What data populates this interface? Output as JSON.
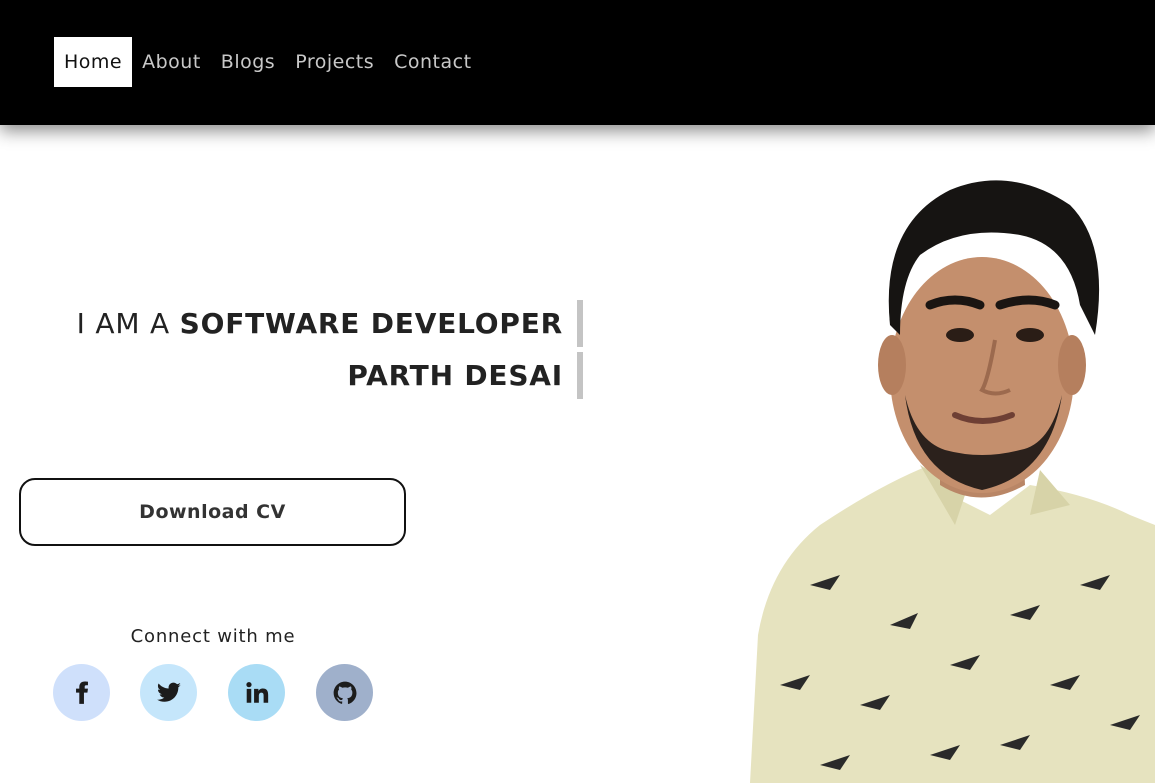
{
  "nav": {
    "items": [
      {
        "label": "Home",
        "active": true
      },
      {
        "label": "About",
        "active": false
      },
      {
        "label": "Blogs",
        "active": false
      },
      {
        "label": "Projects",
        "active": false
      },
      {
        "label": "Contact",
        "active": false
      }
    ]
  },
  "hero": {
    "line1_prefix": "I AM A ",
    "line1_highlight": "SOFTWARE DEVELOPER",
    "line2": "PARTH DESAI"
  },
  "cv_button": {
    "label": "Download CV"
  },
  "connect": {
    "label": "Connect with me",
    "links": [
      {
        "icon": "facebook-icon",
        "bg": "#cfe0fb"
      },
      {
        "icon": "twitter-icon",
        "bg": "#c5e6fb"
      },
      {
        "icon": "linkedin-icon",
        "bg": "#a9dcf5"
      },
      {
        "icon": "github-icon",
        "bg": "#9fb0cb"
      }
    ]
  },
  "colors": {
    "navbar_bg": "#000000",
    "nav_text": "#c8c8c8",
    "nav_active_bg": "#ffffff",
    "page_bg": "#ffffff",
    "text": "#222222",
    "cursor_bar": "#c4c4c4"
  }
}
